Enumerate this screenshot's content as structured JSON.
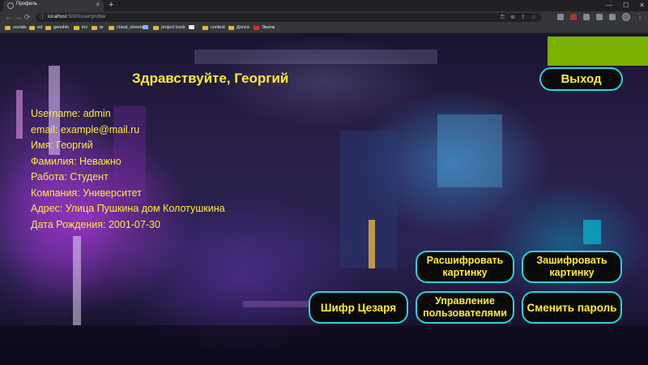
{
  "browser": {
    "tab_title": "Профиль",
    "tab_close": "×",
    "new_tab": "+",
    "window_controls": {
      "minimize": "—",
      "maximize": "☐",
      "close": "✕"
    },
    "nav": {
      "back": "←",
      "forward": "→",
      "reload": "⟳"
    },
    "url_host": "localhost",
    "url_path": ":5000/user/profile/",
    "omnibox_icons": [
      "key-icon",
      "zoom-icon",
      "share-icon",
      "star-icon"
    ],
    "toolbar_icons": [
      "extension-icon-1",
      "extension-icon-2",
      "extension-icon-3",
      "extensions-icon",
      "sidebar-icon"
    ],
    "bookmarks": [
      "socials",
      "ed",
      "genshin",
      "inv",
      "pr",
      "cheat_sheets",
      "",
      "project tools",
      "",
      "contest",
      "Допса",
      "Экилж"
    ]
  },
  "page": {
    "greeting": "Здравствуйте, Георгий",
    "logout": "Выход",
    "profile_lines": [
      "Username: admin",
      "email: example@mail.ru",
      "Имя: Георгий",
      "Фамилия: Неважно",
      "Работа: Студент",
      "Компания: Университет",
      "Адрес: Улица Пушкина дом Колотушкина",
      "Дата Рождения: 2001-07-30"
    ],
    "buttons": {
      "decrypt": "Расшифровать картинку",
      "encrypt": "Зашифровать картинку",
      "caesar": "Шифр Цезаря",
      "users": "Управление пользователями",
      "change_password": "Сменить пароль"
    }
  },
  "colors": {
    "accent_text": "#ffeb3b",
    "button_border": "#2fd3d8",
    "button_bg": "#0a0a0a",
    "green_block": "#7bb100"
  }
}
